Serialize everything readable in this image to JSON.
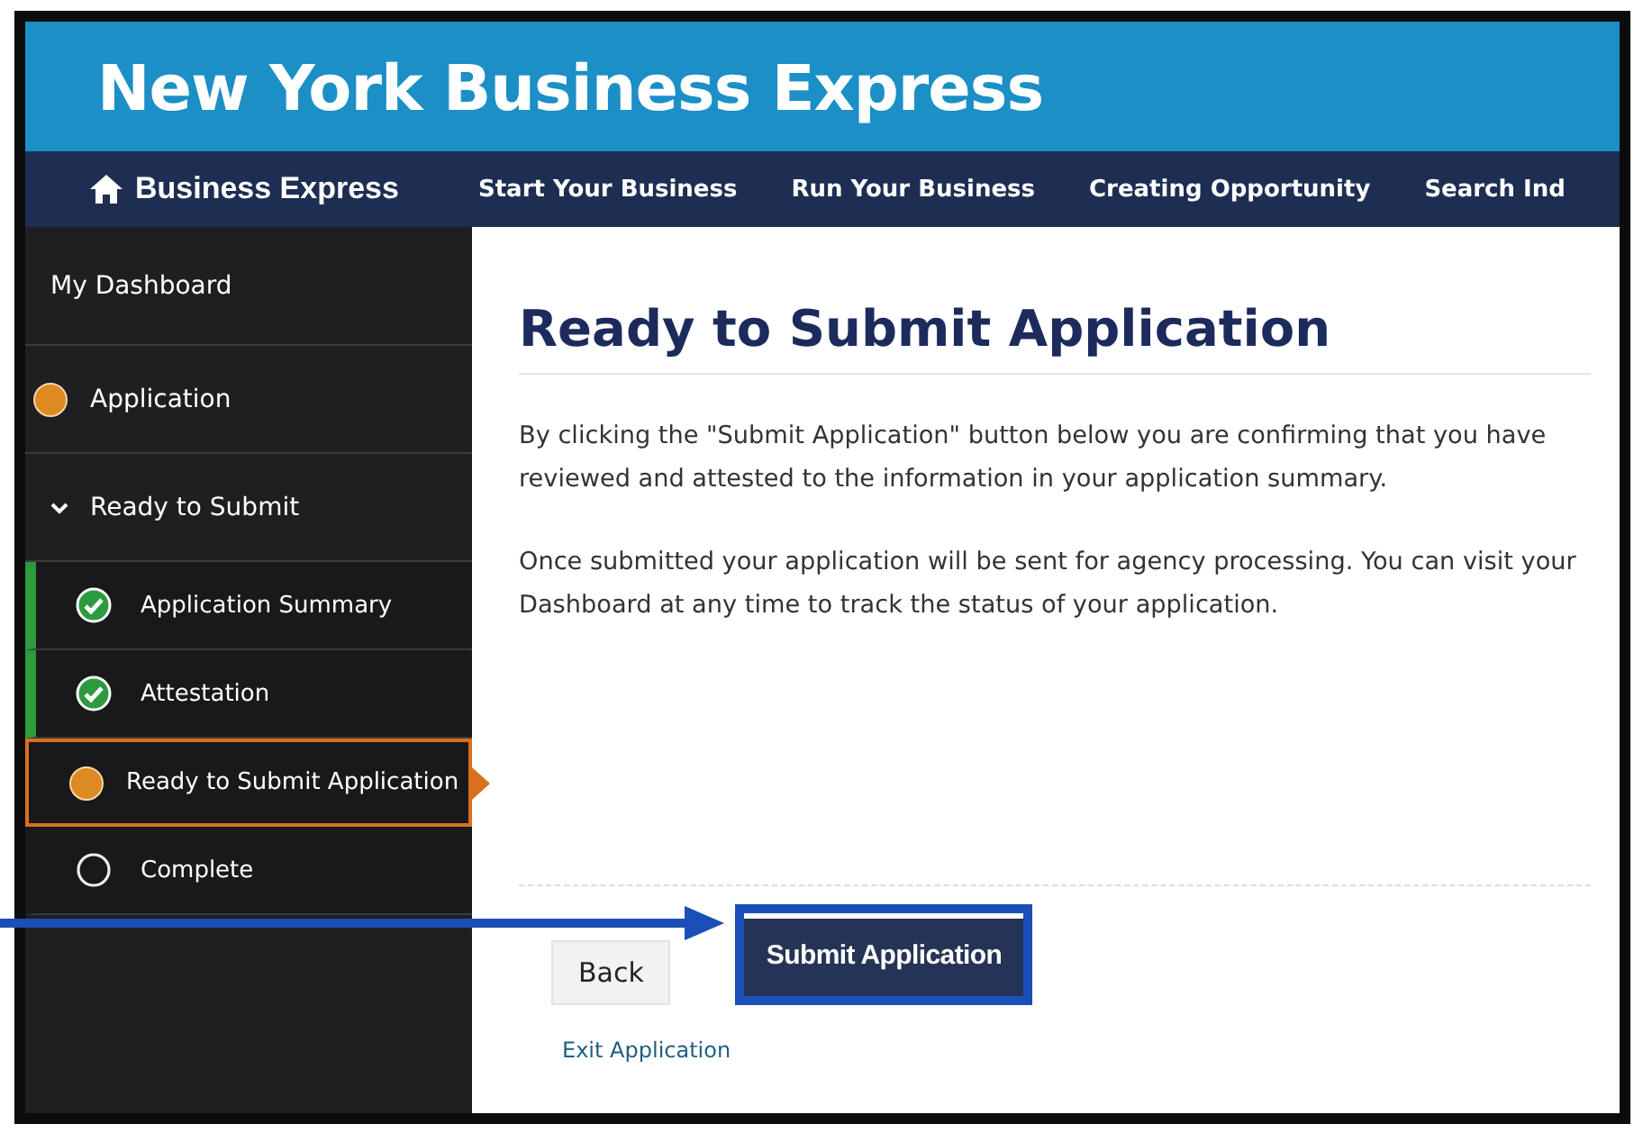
{
  "header": {
    "title": "New York Business Express"
  },
  "nav": {
    "brand": "Business Express",
    "items": [
      "Start Your Business",
      "Run Your Business",
      "Creating Opportunity",
      "Search Ind"
    ]
  },
  "sidebar": {
    "items": [
      {
        "label": "My Dashboard",
        "kind": "link"
      },
      {
        "label": "Application",
        "kind": "in_progress"
      },
      {
        "label": "Ready to Submit",
        "kind": "group",
        "expanded": true,
        "children": [
          {
            "label": "Application Summary",
            "kind": "done",
            "selected": false
          },
          {
            "label": "Attestation",
            "kind": "done",
            "selected": false
          },
          {
            "label": "Ready to Submit Application",
            "kind": "in_progress",
            "selected": true
          },
          {
            "label": "Complete",
            "kind": "todo",
            "selected": false
          }
        ]
      }
    ]
  },
  "main": {
    "heading": "Ready to Submit Application",
    "paragraphs": [
      "By clicking the \"Submit Application\" button below you are confirming that you have reviewed and attested to the information in your application summary.",
      "Once submitted your application will be sent for agency processing. You can visit your Dashboard at any time to track the status of your application."
    ],
    "buttons": [
      {
        "label": "Back",
        "kind": "secondary"
      },
      {
        "label": "Submit Application",
        "kind": "primary"
      }
    ],
    "exit_link": "Exit Application"
  }
}
